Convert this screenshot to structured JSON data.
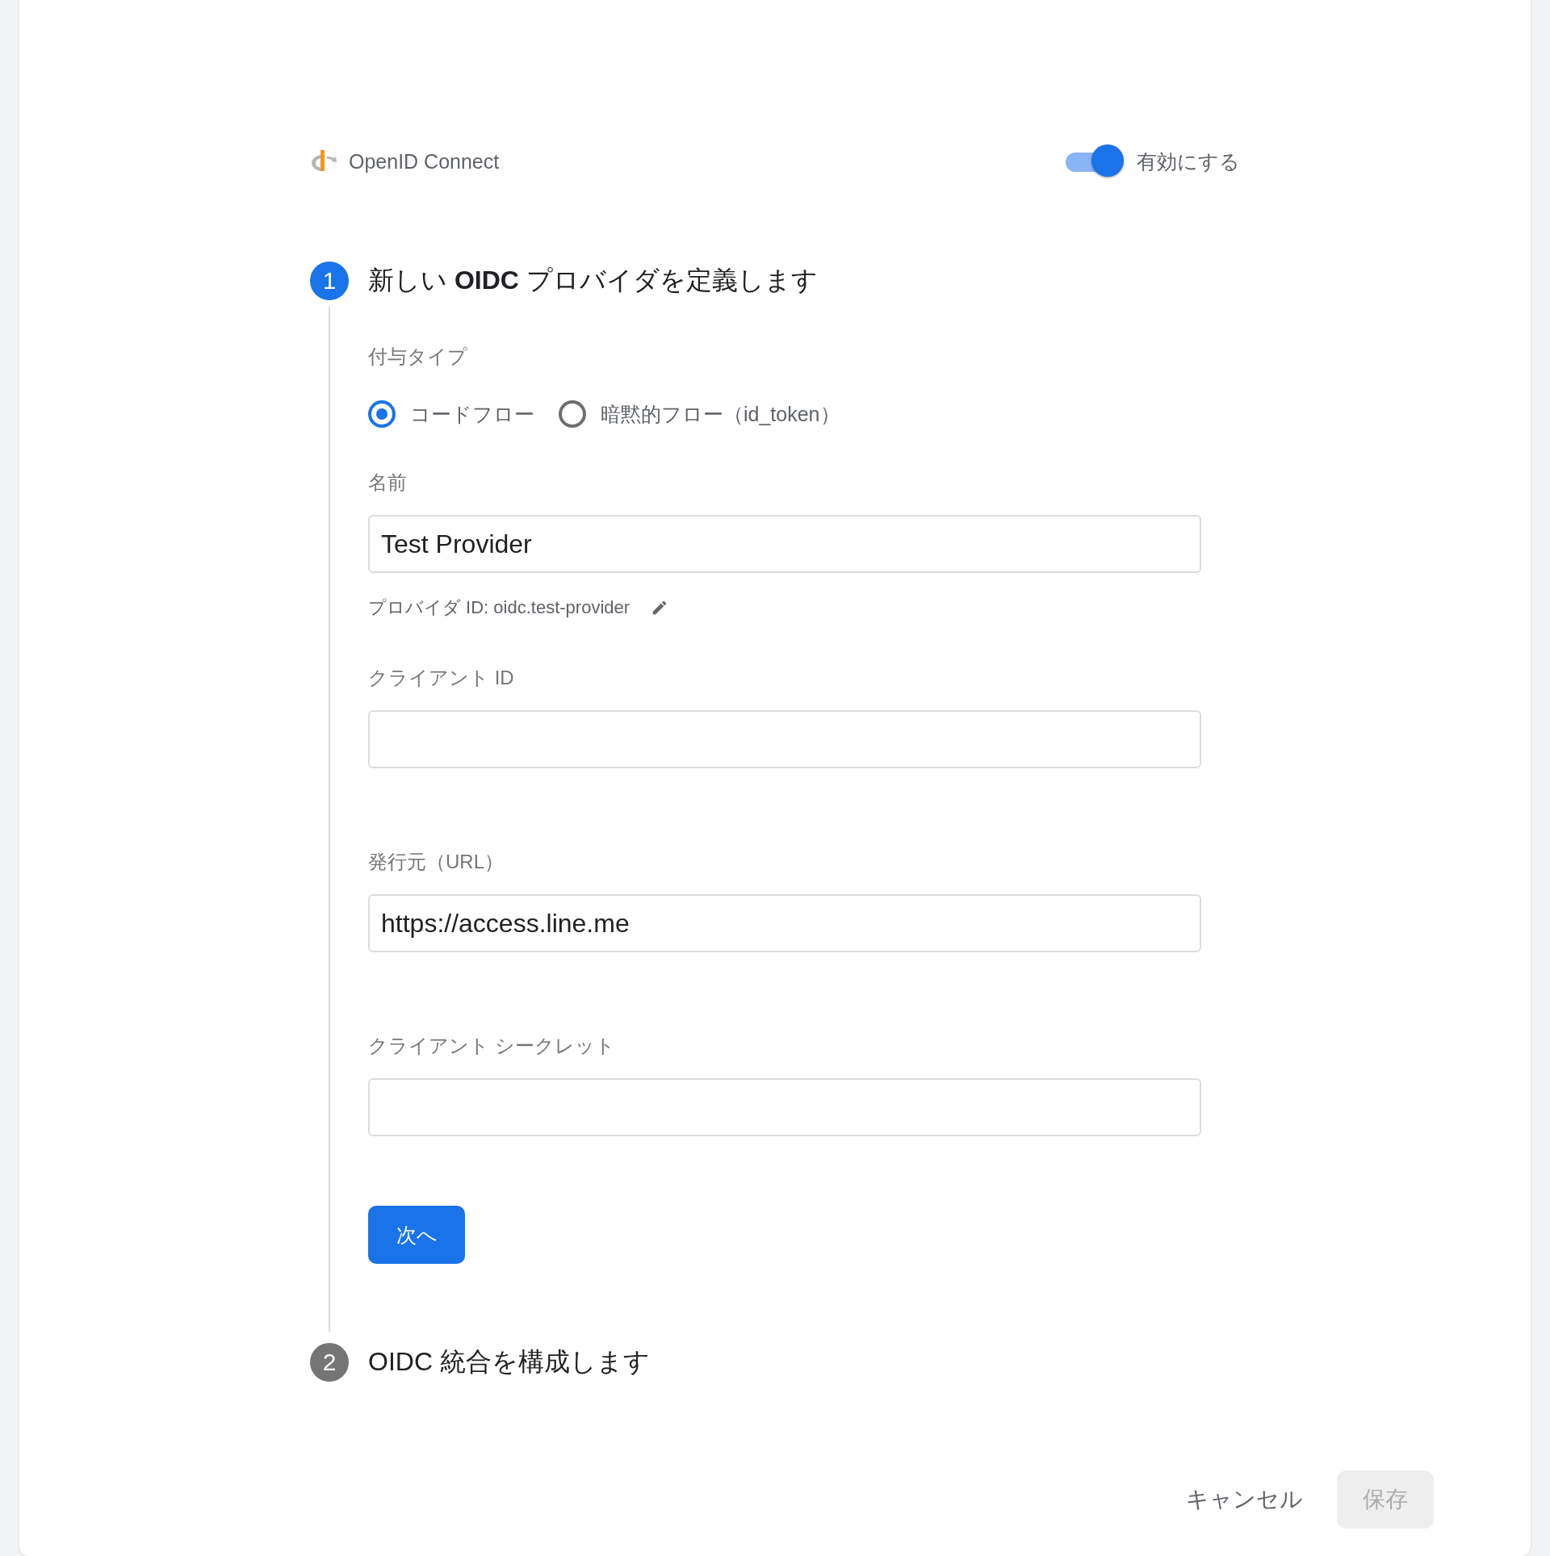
{
  "header": {
    "title": "OpenID Connect",
    "toggle": {
      "label": "有効にする",
      "on": true
    }
  },
  "steps": [
    {
      "number": "1",
      "title": "新しい **OIDC** プロバイダを定義します",
      "active": true
    },
    {
      "number": "2",
      "title": "OIDC 統合を構成します",
      "active": false
    }
  ],
  "grant_type": {
    "label": "付与タイプ",
    "options": [
      {
        "label": "コードフロー",
        "selected": true
      },
      {
        "label": "暗黙的フロー（id_token）",
        "selected": false
      }
    ]
  },
  "fields": [
    {
      "label": "名前",
      "value": "Test Provider",
      "hint": "プロバイダ ID: oidc.test-provider"
    },
    {
      "label": "クライアント ID"
    },
    {
      "label": "発行元（URL）",
      "value": "https://access.line.me"
    },
    {
      "label": "クライアント シークレット"
    }
  ],
  "next_button": "次へ",
  "footer": {
    "cancel": "キャンセル",
    "save": {
      "label": "保存",
      "disabled": true
    }
  }
}
